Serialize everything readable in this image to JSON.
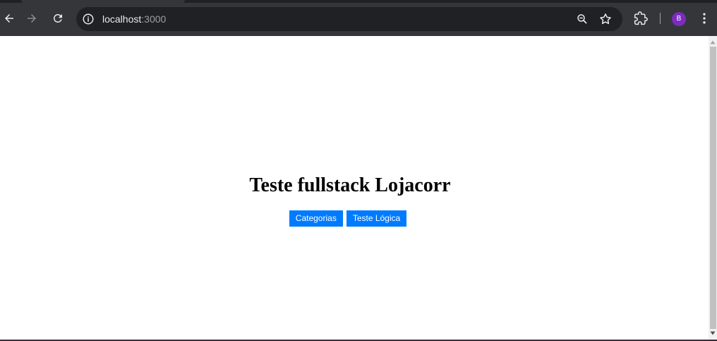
{
  "browser": {
    "address_bar": {
      "host": "localhost",
      "port": ":3000"
    },
    "profile_initial": "B",
    "icons": [
      "back-icon",
      "forward-icon",
      "reload-icon",
      "info-icon",
      "zoom-out-icon",
      "star-icon",
      "extensions-icon",
      "kebab-menu-icon"
    ]
  },
  "page": {
    "title": "Teste fullstack Lojacorr",
    "buttons": {
      "categorias": "Categorias",
      "teste_logica": "Teste Lógica"
    }
  },
  "colors": {
    "button_bg": "#007bff",
    "toolbar_bg": "#35363a",
    "omnibox_bg": "#202124",
    "avatar_bg": "#7b2cbf"
  }
}
